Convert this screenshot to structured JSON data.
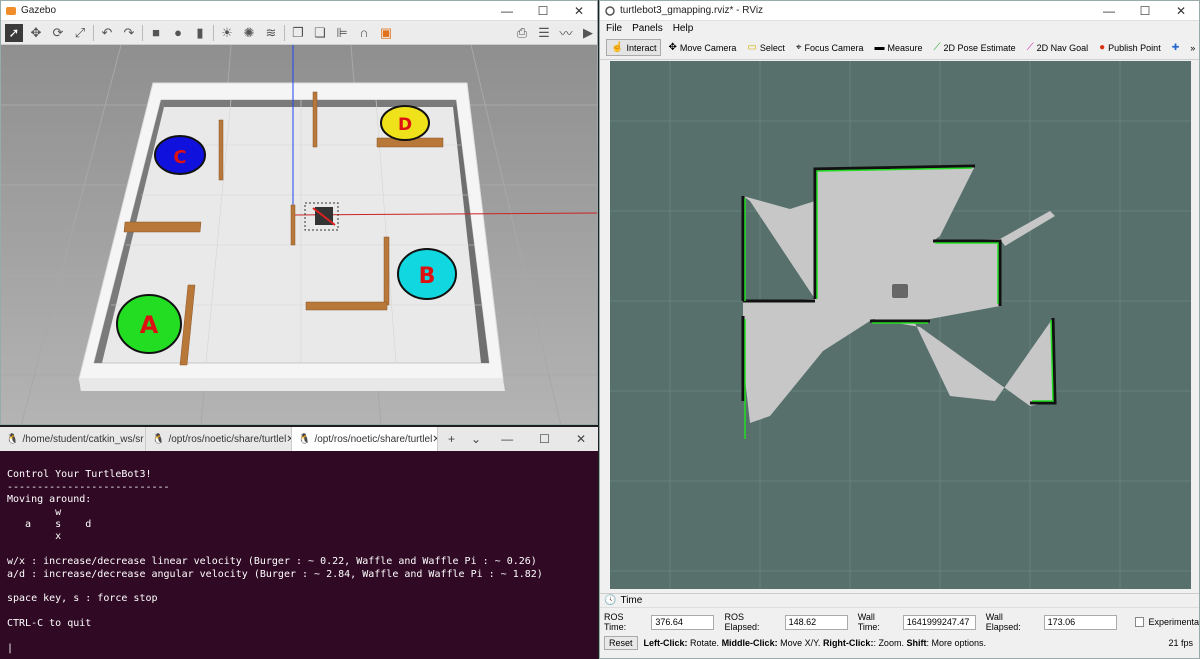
{
  "gazebo": {
    "title": "Gazebo",
    "labels": {
      "A": "A",
      "B": "B",
      "C": "C",
      "D": "D"
    }
  },
  "terminal": {
    "tabs": [
      {
        "label": "/home/student/catkin_ws/sr",
        "active": false
      },
      {
        "label": "/opt/ros/noetic/share/turtlel",
        "active": false
      },
      {
        "label": "/opt/ros/noetic/share/turtlel",
        "active": true
      }
    ],
    "lines": [
      "",
      "Control Your TurtleBot3!",
      "---------------------------",
      "Moving around:",
      "        w",
      "   a    s    d",
      "        x",
      "",
      "w/x : increase/decrease linear velocity (Burger : ~ 0.22, Waffle and Waffle Pi : ~ 0.26)",
      "a/d : increase/decrease angular velocity (Burger : ~ 2.84, Waffle and Waffle Pi : ~ 1.82)",
      "",
      "space key, s : force stop",
      "",
      "CTRL-C to quit",
      "",
      "|"
    ]
  },
  "rviz": {
    "title": "turtlebot3_gmapping.rviz* - RViz",
    "menu": [
      "File",
      "Panels",
      "Help"
    ],
    "tools": [
      {
        "label": "Interact",
        "icon": "hand-icon",
        "active": true
      },
      {
        "label": "Move Camera",
        "icon": "camera-icon",
        "active": false
      },
      {
        "label": "Select",
        "icon": "select-icon",
        "active": false
      },
      {
        "label": "Focus Camera",
        "icon": "focus-icon",
        "active": false
      },
      {
        "label": "Measure",
        "icon": "ruler-icon",
        "active": false
      },
      {
        "label": "2D Pose Estimate",
        "icon": "pose-arrow-icon",
        "active": false
      },
      {
        "label": "2D Nav Goal",
        "icon": "nav-arrow-icon",
        "active": false
      },
      {
        "label": "Publish Point",
        "icon": "pin-icon",
        "active": false
      }
    ],
    "time": {
      "header": "Time",
      "ros_time_label": "ROS Time:",
      "ros_time": "376.64",
      "ros_elapsed_label": "ROS Elapsed:",
      "ros_elapsed": "148.62",
      "wall_time_label": "Wall Time:",
      "wall_time": "1641999247.47",
      "wall_elapsed_label": "Wall Elapsed:",
      "wall_elapsed": "173.06",
      "experimental_label": "Experimental"
    },
    "status": {
      "reset_label": "Reset",
      "hint_b1": "Left-Click:",
      "hint_t1": " Rotate. ",
      "hint_b2": "Middle-Click:",
      "hint_t2": " Move X/Y. ",
      "hint_b3": "Right-Click:",
      "hint_t3": ": Zoom. ",
      "hint_b4": "Shift",
      "hint_t4": ": More options.",
      "fps": "21 fps"
    }
  },
  "window_controls": {
    "min": "—",
    "max": "☐",
    "close": "✕"
  }
}
